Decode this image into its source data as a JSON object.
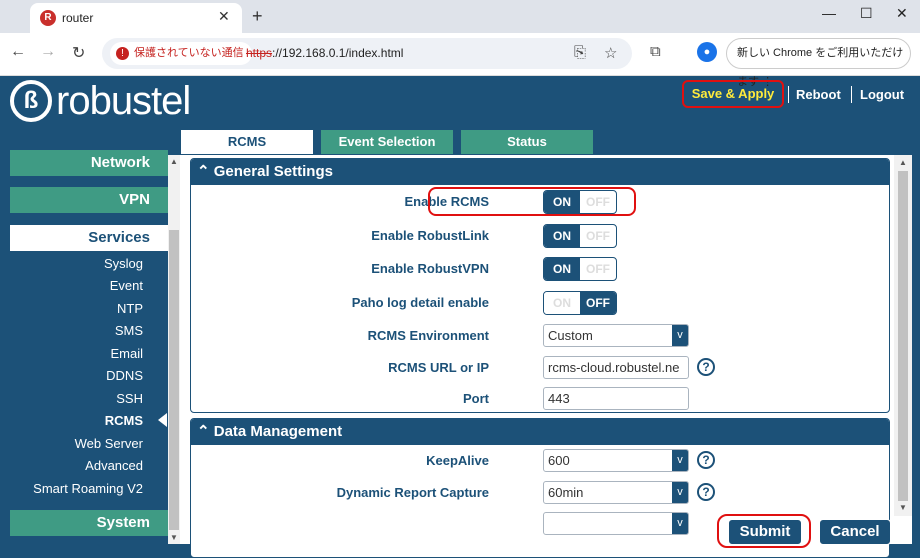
{
  "browser": {
    "tab_title": "router",
    "favicon_letter": "R",
    "security_text": "保護されていない通信",
    "url_scheme": "https",
    "url_rest": "://192.168.0.1/index.html",
    "chrome_prompt": "新しい Chrome をご利用いただけます"
  },
  "header": {
    "brand": "robustel",
    "save_apply": "Save & Apply",
    "reboot": "Reboot",
    "logout": "Logout"
  },
  "page_tabs": [
    "RCMS",
    "Event Selection",
    "Status"
  ],
  "sidebar": {
    "categories": {
      "network": "Network",
      "vpn": "VPN",
      "services": "Services",
      "system": "System"
    },
    "items": [
      "Syslog",
      "Event",
      "NTP",
      "SMS",
      "Email",
      "DDNS",
      "SSH",
      "RCMS",
      "Web Server",
      "Advanced",
      "Smart Roaming V2"
    ],
    "active_item": "RCMS"
  },
  "general_settings": {
    "title": "General Settings",
    "enable_rcms": {
      "label": "Enable RCMS",
      "state": "ON"
    },
    "enable_robustlink": {
      "label": "Enable RobustLink",
      "state": "ON"
    },
    "enable_robustvpn": {
      "label": "Enable RobustVPN",
      "state": "ON"
    },
    "paho_log": {
      "label": "Paho log detail enable",
      "state": "OFF"
    },
    "rcms_env": {
      "label": "RCMS Environment",
      "value": "Custom"
    },
    "rcms_url": {
      "label": "RCMS URL or IP",
      "value": "rcms-cloud.robustel.ne"
    },
    "port": {
      "label": "Port",
      "value": "443"
    }
  },
  "toggle_text": {
    "on": "ON",
    "off": "OFF"
  },
  "data_management": {
    "title": "Data Management",
    "keepalive": {
      "label": "KeepAlive",
      "value": "600"
    },
    "dynamic_report": {
      "label": "Dynamic Report Capture",
      "value": "60min"
    }
  },
  "buttons": {
    "submit": "Submit",
    "cancel": "Cancel"
  },
  "colors": {
    "primary": "#1c5178",
    "accent_green": "#3f9b84",
    "save_yellow": "#ffeb3b",
    "highlight_red": "#e01010"
  }
}
